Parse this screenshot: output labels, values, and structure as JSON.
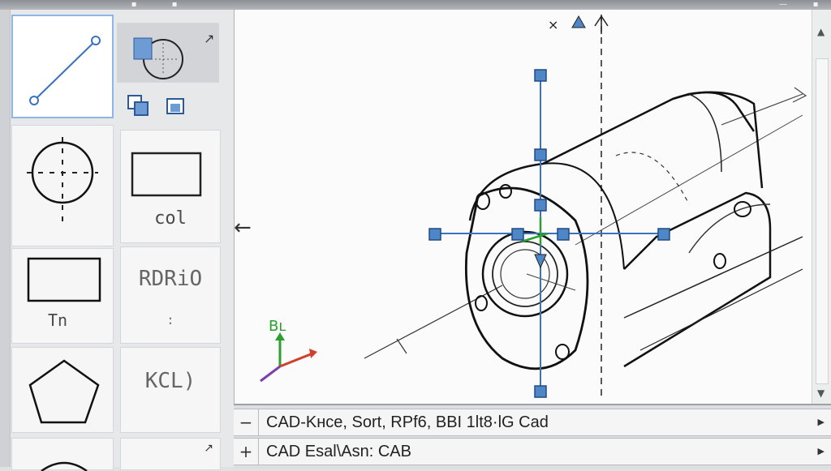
{
  "palette": {
    "tiles": [
      {
        "id": "line",
        "label": ""
      },
      {
        "id": "circle-edit",
        "label": ""
      },
      {
        "id": "circle",
        "label": ""
      },
      {
        "id": "col",
        "label": "col"
      },
      {
        "id": "rect",
        "label": "Tn"
      },
      {
        "id": "text",
        "label": "RDRiO"
      },
      {
        "id": "polygon",
        "label": ""
      },
      {
        "id": "kcl",
        "label": "KCL)"
      }
    ],
    "colon_label": ":"
  },
  "viewport": {
    "top_marker_x": "×",
    "axis_label": "Bʟ",
    "colors": {
      "grip": "#4f86c6",
      "line": "#3a72c0",
      "axis_green": "#2ca02c",
      "axis_red": "#d0402a",
      "axis_purple": "#7b3fb0"
    }
  },
  "command": {
    "line1": "CAD-Kнce, Sort, RPf6, BBI 1lt8·lG Cad",
    "line2": "CAD Esal\\Asn:  CAB",
    "sign1": "−",
    "sign2": "+",
    "arrow": "▶"
  }
}
